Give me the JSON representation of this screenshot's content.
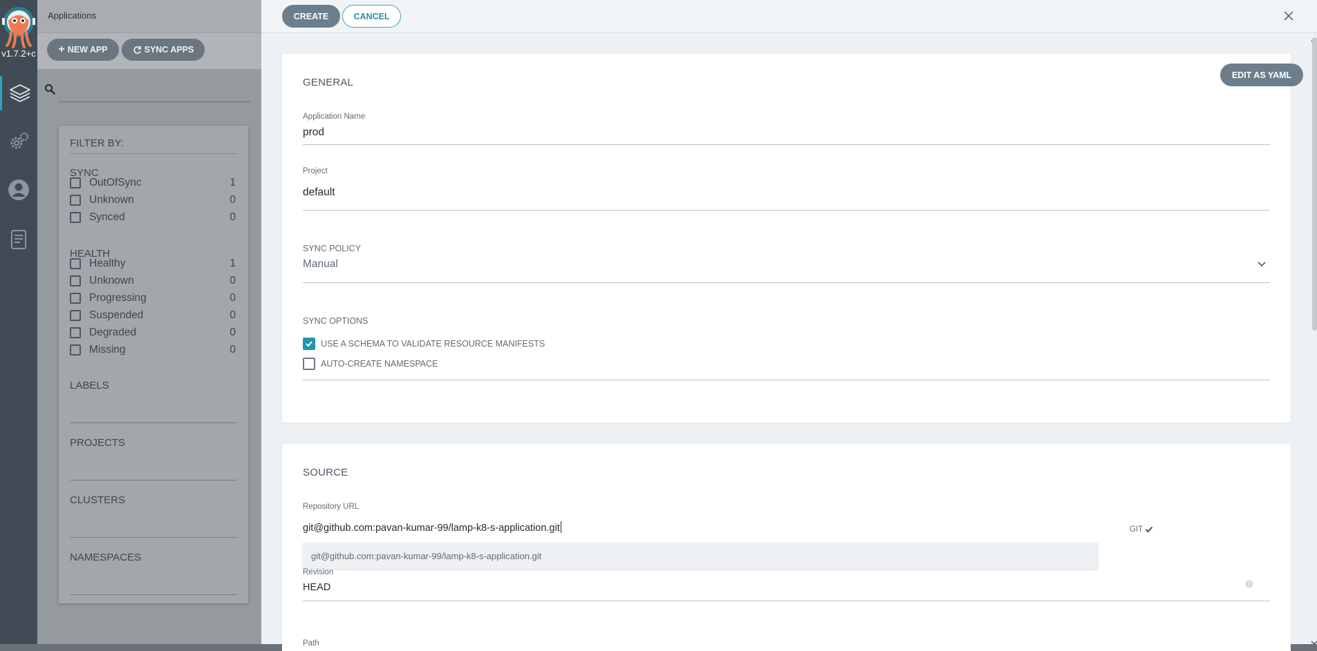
{
  "nav": {
    "version": "v1.7.2+c",
    "items": [
      {
        "name": "applications",
        "icon": "layers-icon",
        "active": true
      },
      {
        "name": "settings",
        "icon": "gears-icon"
      },
      {
        "name": "user-info",
        "icon": "user-icon"
      },
      {
        "name": "documentation",
        "icon": "docs-icon"
      }
    ]
  },
  "apps_panel": {
    "title": "Applications",
    "new_app_label": "NEW APP",
    "sync_apps_label": "SYNC APPS",
    "filter": {
      "title": "FILTER BY:",
      "sync_title": "SYNC",
      "sync": [
        {
          "label": "OutOfSync",
          "count": "1"
        },
        {
          "label": "Unknown",
          "count": "0"
        },
        {
          "label": "Synced",
          "count": "0"
        }
      ],
      "health_title": "HEALTH",
      "health": [
        {
          "label": "Healthy",
          "count": "1"
        },
        {
          "label": "Unknown",
          "count": "0"
        },
        {
          "label": "Progressing",
          "count": "0"
        },
        {
          "label": "Suspended",
          "count": "0"
        },
        {
          "label": "Degraded",
          "count": "0"
        },
        {
          "label": "Missing",
          "count": "0"
        }
      ],
      "labels_title": "LABELS",
      "projects_title": "PROJECTS",
      "clusters_title": "CLUSTERS",
      "namespaces_title": "NAMESPACES"
    }
  },
  "create_panel": {
    "create_label": "CREATE",
    "cancel_label": "CANCEL",
    "general": {
      "title": "GENERAL",
      "edit_yaml_label": "EDIT AS YAML",
      "app_name_label": "Application Name",
      "app_name_value": "prod",
      "project_label": "Project",
      "project_value": "default",
      "sync_policy_title": "SYNC POLICY",
      "sync_policy_value": "Manual",
      "sync_options_title": "SYNC OPTIONS",
      "options": [
        {
          "label": "USE A SCHEMA TO VALIDATE RESOURCE MANIFESTS",
          "checked": true
        },
        {
          "label": "AUTO-CREATE NAMESPACE",
          "checked": false
        }
      ]
    },
    "source": {
      "title": "SOURCE",
      "repo_label": "Repository URL",
      "repo_value": "git@github.com:pavan-kumar-99/lamp-k8-s-application.git",
      "repo_type": "GIT",
      "suggestion": "git@github.com:pavan-kumar-99/lamp-k8-s-application.git",
      "revision_label": "Revision",
      "revision_value": "HEAD",
      "path_label": "Path"
    }
  },
  "colors": {
    "accent": "#2196ad",
    "button": "#6c7e8c",
    "nav": "#404b55"
  }
}
